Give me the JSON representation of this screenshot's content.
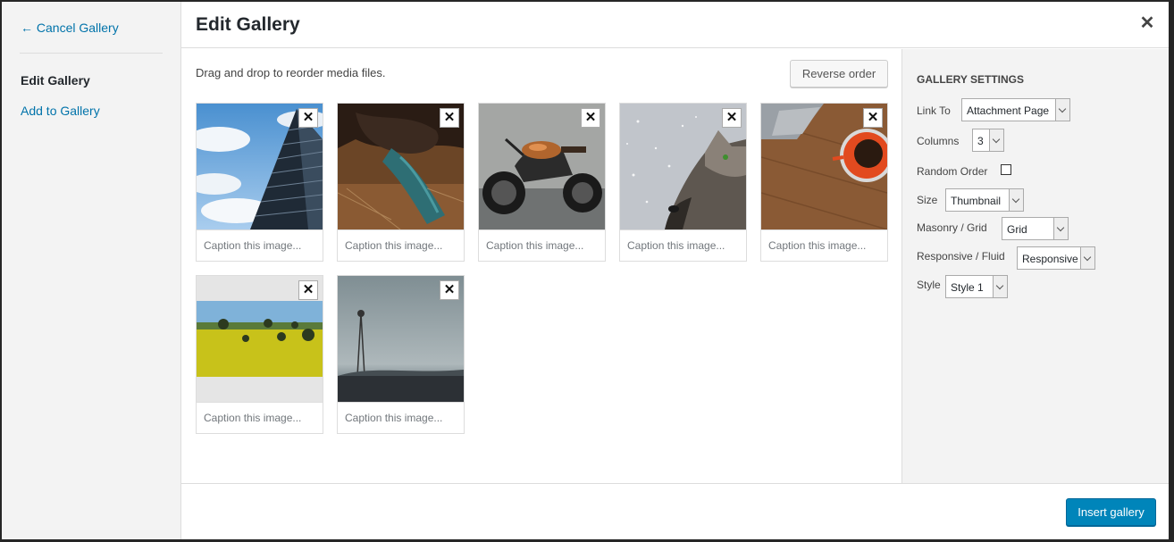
{
  "menu": {
    "cancel": "← Cancel Gallery",
    "active": "Edit Gallery",
    "add": "Add to Gallery"
  },
  "title": "Edit Gallery",
  "instructions": "Drag and drop to reorder media files.",
  "reverse_label": "Reverse order",
  "caption_placeholder": "Caption this image...",
  "images": [
    {
      "name": "building"
    },
    {
      "name": "jacket-tie"
    },
    {
      "name": "motorcycle"
    },
    {
      "name": "wolf-snow"
    },
    {
      "name": "laptop-coffee"
    },
    {
      "name": "yellow-field"
    },
    {
      "name": "foggy-windmill"
    }
  ],
  "settings": {
    "heading": "Gallery Settings",
    "link_to_label": "Link To",
    "link_to_value": "Attachment Page",
    "columns_label": "Columns",
    "columns_value": "3",
    "random_label": "Random Order",
    "size_label": "Size",
    "size_value": "Thumbnail",
    "masonry_label": "Masonry / Grid",
    "masonry_value": "Grid",
    "responsive_label": "Responsive / Fluid",
    "responsive_value": "Responsive",
    "style_label": "Style",
    "style_value": "Style 1"
  },
  "insert_label": "Insert gallery",
  "colors": {
    "accent": "#0085ba",
    "link": "#0073aa"
  }
}
